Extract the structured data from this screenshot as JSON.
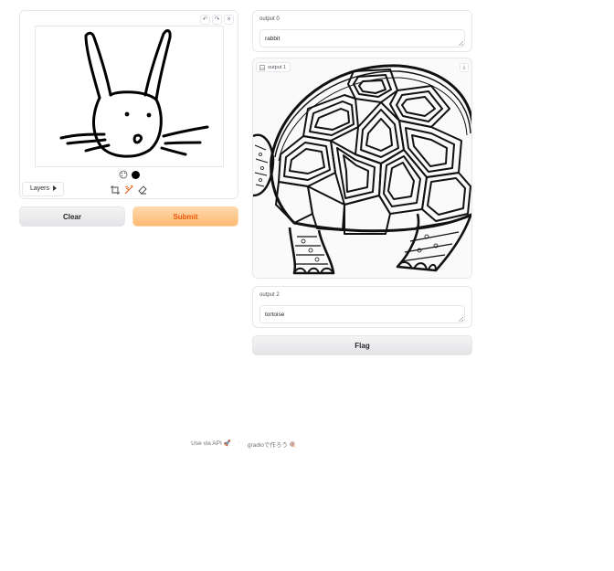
{
  "sketch": {
    "layers_label": "Layers",
    "brush_color": "#000000"
  },
  "buttons": {
    "clear": "Clear",
    "submit": "Submit",
    "flag": "Flag"
  },
  "outputs": [
    {
      "label": "output 0",
      "value": "rabbit"
    },
    {
      "label": "output 1"
    },
    {
      "label": "output 2",
      "value": "tortoise"
    }
  ],
  "footer": {
    "api": "Use via API",
    "api_emoji": "🚀",
    "separator": "·",
    "built_with": "gradioで作ろう",
    "built_emoji": "🍭"
  },
  "colors": {
    "accent": "#ea580c",
    "submit_bg": "#fdba74",
    "border": "#e5e7eb"
  }
}
